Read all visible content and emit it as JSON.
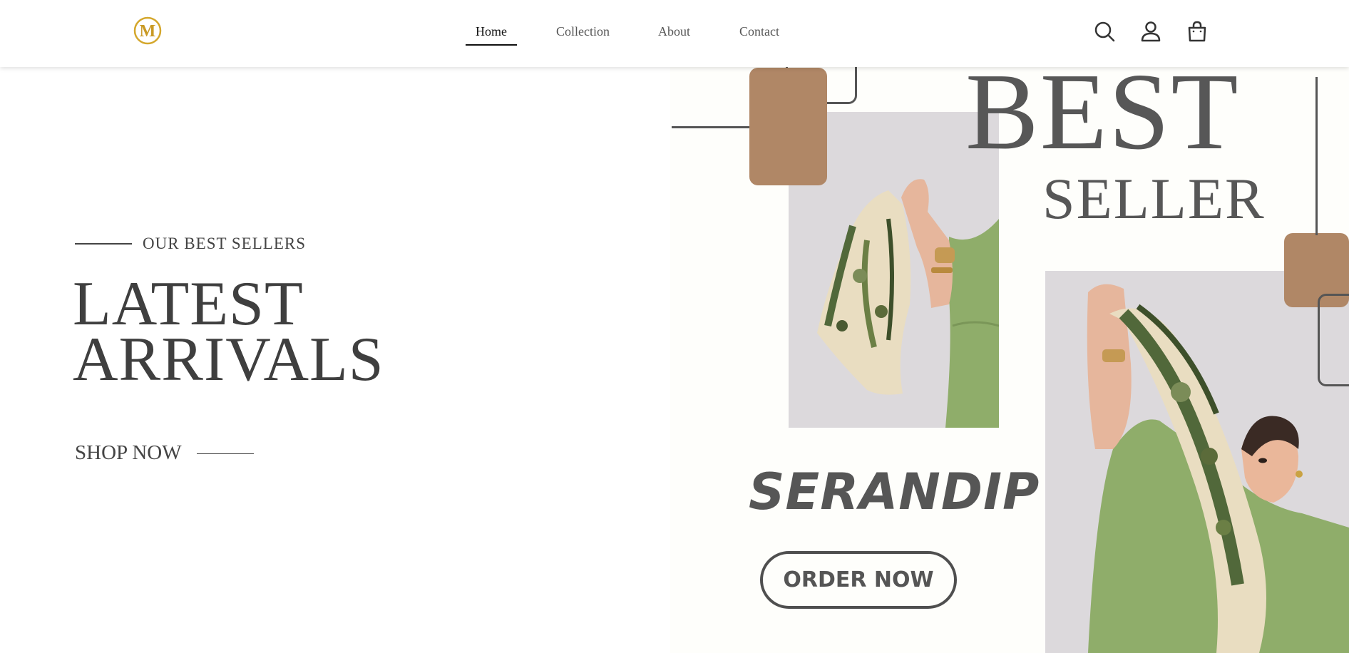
{
  "header": {
    "logo_text": "M",
    "nav": [
      {
        "label": "Home",
        "active": true
      },
      {
        "label": "Collection",
        "active": false
      },
      {
        "label": "About",
        "active": false
      },
      {
        "label": "Contact",
        "active": false
      }
    ],
    "icons": [
      "search-icon",
      "user-icon",
      "shopping-bag-icon"
    ]
  },
  "hero_left": {
    "eyebrow": "OUR BEST SELLERS",
    "headline_line1": "LATEST",
    "headline_line2": "ARRIVALS",
    "cta": "SHOP NOW"
  },
  "hero_right": {
    "title_line1": "BEST",
    "title_line2": "SELLER",
    "brand": "SERANDIP",
    "cta": "ORDER NOW"
  },
  "colors": {
    "accent_brown": "#b08766",
    "text_dark": "#575757",
    "logo_gold": "#d4a72c",
    "photo_bg": "#dcd9dc",
    "sleeve_green": "#8fad6a"
  }
}
